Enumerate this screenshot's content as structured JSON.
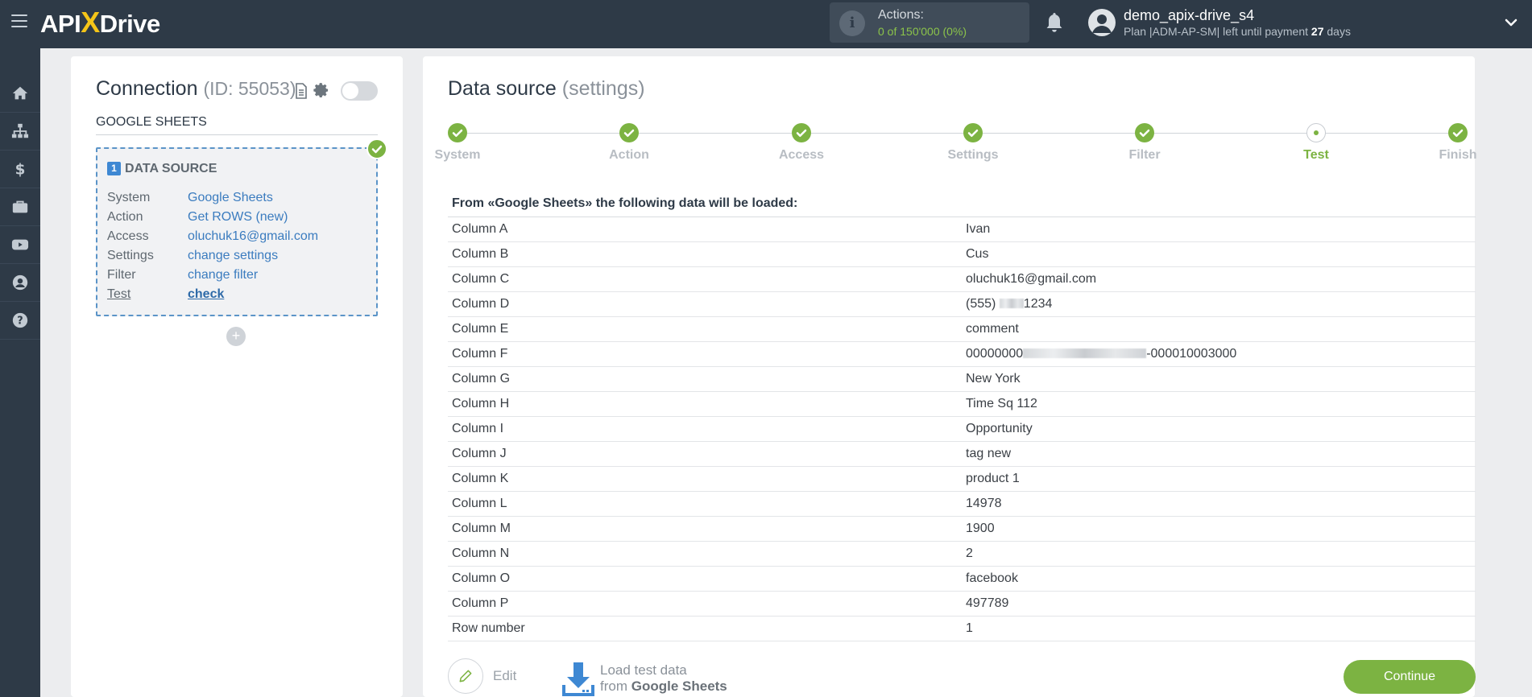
{
  "app": {
    "logo_left": "API",
    "logo_x": "X",
    "logo_right": "Drive"
  },
  "header": {
    "actions_label": "Actions:",
    "actions_value": "0 of 150'000 (0%)",
    "user_name": "demo_apix-drive_s4",
    "plan_prefix": "Plan |ADM-AP-SM| left until payment ",
    "plan_days": "27",
    "plan_suffix": " days"
  },
  "sidebar": {
    "items": [
      "home-icon",
      "sitemap-icon",
      "dollar-icon",
      "briefcase-icon",
      "video-icon",
      "user-icon",
      "help-icon"
    ]
  },
  "connection": {
    "title": "Connection",
    "id_text": "(ID: 55053)",
    "service_name": "GOOGLE SHEETS",
    "card_number": "1",
    "card_title": "DATA SOURCE",
    "rows": [
      {
        "key": "System",
        "value": "Google Sheets"
      },
      {
        "key": "Action",
        "value": "Get ROWS (new)"
      },
      {
        "key": "Access",
        "value": "oluchuk16@gmail.com"
      },
      {
        "key": "Settings",
        "value": "change settings"
      },
      {
        "key": "Filter",
        "value": "change filter"
      },
      {
        "key": "Test",
        "value": "check"
      }
    ],
    "add_symbol": "+"
  },
  "datasource": {
    "title": "Data source",
    "subtitle": "(settings)",
    "steps": [
      "System",
      "Action",
      "Access",
      "Settings",
      "Filter",
      "Test",
      "Finish"
    ],
    "current_step": "Test",
    "table_header": "From «Google Sheets» the following data will be loaded:",
    "table_rows": [
      {
        "col": "Column A",
        "val": "Ivan"
      },
      {
        "col": "Column B",
        "val": "Cus"
      },
      {
        "col": "Column C",
        "val": "oluchuk16@gmail.com"
      },
      {
        "col": "Column D",
        "val_pre": "(555) ",
        "val_post": "1234"
      },
      {
        "col": "Column E",
        "val": "comment"
      },
      {
        "col": "Column F",
        "val_pre": "00000000",
        "val_post": "-000010003000"
      },
      {
        "col": "Column G",
        "val": "New York"
      },
      {
        "col": "Column H",
        "val": "Time Sq 112"
      },
      {
        "col": "Column I",
        "val": "Opportunity"
      },
      {
        "col": "Column J",
        "val": "tag new"
      },
      {
        "col": "Column K",
        "val": "product 1"
      },
      {
        "col": "Column L",
        "val": "14978"
      },
      {
        "col": "Column M",
        "val": "1900"
      },
      {
        "col": "Column N",
        "val": "2"
      },
      {
        "col": "Column O",
        "val": "facebook"
      },
      {
        "col": "Column P",
        "val": "497789"
      },
      {
        "col": "Row number",
        "val": "1"
      }
    ],
    "edit_label": "Edit",
    "load_line1": "Load test data",
    "load_line2_prefix": "from ",
    "load_line2_service": "Google Sheets",
    "continue_label": "Continue"
  },
  "colors": {
    "topbar": "#2e3a47",
    "accent_green": "#7cb342",
    "link_blue": "#3b7cbf"
  }
}
